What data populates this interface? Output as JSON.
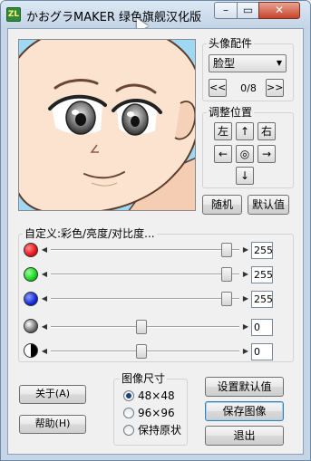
{
  "window": {
    "title": "かおグラMAKER 绿色旗舰汉化版",
    "app_icon": "ZL",
    "controls": {
      "minimize": "–",
      "maximize": "▭",
      "close": "✕"
    }
  },
  "parts": {
    "group_title": "头像配件",
    "selected": "脸型",
    "page": "0/8",
    "prev": "<<",
    "next": ">>"
  },
  "position": {
    "group_title": "调整位置",
    "left": "左",
    "right": "右",
    "up": "↑",
    "down": "↓",
    "arrow_left": "←",
    "arrow_right": "→",
    "center": "◎"
  },
  "buttons": {
    "random": "随机",
    "default": "默认值",
    "about": "关于(A)",
    "help": "帮助(H)",
    "set_default": "设置默认值",
    "save_image": "保存图像",
    "exit": "退出"
  },
  "custom": {
    "group_title": "自定义:彩色/亮度/对比度...",
    "sliders": [
      {
        "name": "red",
        "value": "255",
        "level": 1.0
      },
      {
        "name": "green",
        "value": "255",
        "level": 1.0
      },
      {
        "name": "blue",
        "value": "255",
        "level": 1.0
      },
      {
        "name": "brightness",
        "value": "0",
        "level": 0.5
      },
      {
        "name": "contrast",
        "value": "0",
        "level": 0.5
      }
    ]
  },
  "image_size": {
    "group_title": "图像尺寸",
    "options": [
      "48×48",
      "96×96",
      "保持原状"
    ],
    "selected": "48×48"
  },
  "colors": {
    "red": "#e8141a",
    "green": "#16d41e",
    "blue": "#1428d8",
    "sky": "#9ed8f3",
    "skin": "#fbe3cf"
  },
  "icons": {
    "arrow": "triangle-glyph",
    "cursor": "mouse-pointer-icon"
  }
}
